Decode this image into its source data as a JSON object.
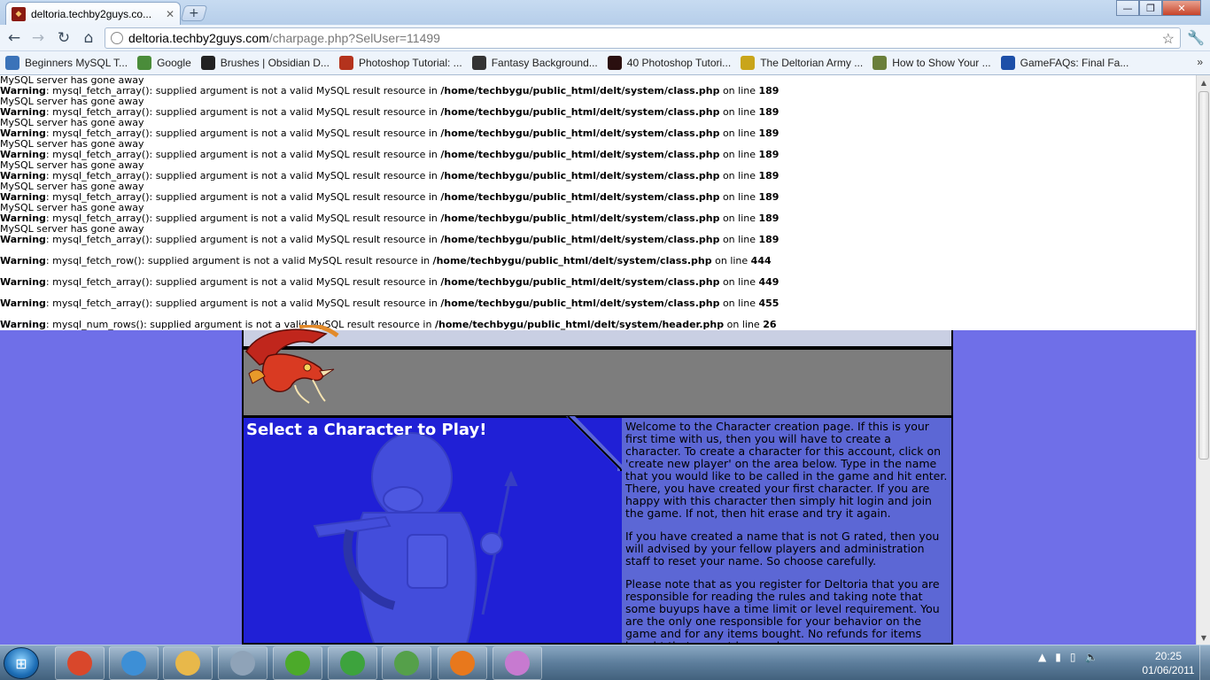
{
  "browser": {
    "tab_title": "deltoria.techby2guys.co...",
    "new_tab": "+",
    "url_host": "deltoria.techby2guys.com",
    "url_path": "/charpage.php?SelUser=11499"
  },
  "bookmarks": [
    {
      "label": "Beginners MySQL T...",
      "icon": "bookmark-mysql-icon",
      "color": "#3b73b9"
    },
    {
      "label": "Google",
      "icon": "bookmark-google-icon",
      "color": "#4a8c3a"
    },
    {
      "label": "Brushes | Obsidian D...",
      "icon": "bookmark-obsidian-icon",
      "color": "#222222"
    },
    {
      "label": "Photoshop Tutorial: ...",
      "icon": "bookmark-photoshop-icon",
      "color": "#b4331d"
    },
    {
      "label": "Fantasy Background...",
      "icon": "bookmark-fantasy-icon",
      "color": "#333333"
    },
    {
      "label": "40 Photoshop Tutori...",
      "icon": "bookmark-v-icon",
      "color": "#2a0f0f"
    },
    {
      "label": "The Deltorian Army ...",
      "icon": "bookmark-deltorian-icon",
      "color": "#c9a51a"
    },
    {
      "label": "How to Show Your ...",
      "icon": "bookmark-howto-icon",
      "color": "#6a7f3a"
    },
    {
      "label": "GameFAQs: Final Fa...",
      "icon": "bookmark-gamefaqs-icon",
      "color": "#1d4fa8"
    }
  ],
  "bookmarks_more": "»",
  "errors": [
    {
      "type": "plain",
      "text": "MySQL server has gone away"
    },
    {
      "type": "warn",
      "label": "Warning",
      "fn": ": mysql_fetch_array(): supplied argument is not a valid MySQL result resource in ",
      "path": "/home/techbygu/public_html/delt/system/class.php",
      "on": " on line ",
      "line": "189"
    },
    {
      "type": "plain",
      "text": "MySQL server has gone away"
    },
    {
      "type": "warn",
      "label": "Warning",
      "fn": ": mysql_fetch_array(): supplied argument is not a valid MySQL result resource in ",
      "path": "/home/techbygu/public_html/delt/system/class.php",
      "on": " on line ",
      "line": "189"
    },
    {
      "type": "plain",
      "text": "MySQL server has gone away"
    },
    {
      "type": "warn",
      "label": "Warning",
      "fn": ": mysql_fetch_array(): supplied argument is not a valid MySQL result resource in ",
      "path": "/home/techbygu/public_html/delt/system/class.php",
      "on": " on line ",
      "line": "189"
    },
    {
      "type": "plain",
      "text": "MySQL server has gone away"
    },
    {
      "type": "warn",
      "label": "Warning",
      "fn": ": mysql_fetch_array(): supplied argument is not a valid MySQL result resource in ",
      "path": "/home/techbygu/public_html/delt/system/class.php",
      "on": " on line ",
      "line": "189"
    },
    {
      "type": "plain",
      "text": "MySQL server has gone away"
    },
    {
      "type": "warn",
      "label": "Warning",
      "fn": ": mysql_fetch_array(): supplied argument is not a valid MySQL result resource in ",
      "path": "/home/techbygu/public_html/delt/system/class.php",
      "on": " on line ",
      "line": "189"
    },
    {
      "type": "plain",
      "text": "MySQL server has gone away"
    },
    {
      "type": "warn",
      "label": "Warning",
      "fn": ": mysql_fetch_array(): supplied argument is not a valid MySQL result resource in ",
      "path": "/home/techbygu/public_html/delt/system/class.php",
      "on": " on line ",
      "line": "189"
    },
    {
      "type": "plain",
      "text": "MySQL server has gone away"
    },
    {
      "type": "warn",
      "label": "Warning",
      "fn": ": mysql_fetch_array(): supplied argument is not a valid MySQL result resource in ",
      "path": "/home/techbygu/public_html/delt/system/class.php",
      "on": " on line ",
      "line": "189"
    },
    {
      "type": "plain",
      "text": "MySQL server has gone away"
    },
    {
      "type": "warn",
      "label": "Warning",
      "fn": ": mysql_fetch_array(): supplied argument is not a valid MySQL result resource in ",
      "path": "/home/techbygu/public_html/delt/system/class.php",
      "on": " on line ",
      "line": "189"
    },
    {
      "type": "blank"
    },
    {
      "type": "warn",
      "label": "Warning",
      "fn": ": mysql_fetch_row(): supplied argument is not a valid MySQL result resource in ",
      "path": "/home/techbygu/public_html/delt/system/class.php",
      "on": " on line ",
      "line": "444"
    },
    {
      "type": "blank"
    },
    {
      "type": "warn",
      "label": "Warning",
      "fn": ": mysql_fetch_array(): supplied argument is not a valid MySQL result resource in ",
      "path": "/home/techbygu/public_html/delt/system/class.php",
      "on": " on line ",
      "line": "449"
    },
    {
      "type": "blank"
    },
    {
      "type": "warn",
      "label": "Warning",
      "fn": ": mysql_fetch_array(): supplied argument is not a valid MySQL result resource in ",
      "path": "/home/techbygu/public_html/delt/system/class.php",
      "on": " on line ",
      "line": "455"
    },
    {
      "type": "blank"
    },
    {
      "type": "warn",
      "label": "Warning",
      "fn": ": mysql_num_rows(): supplied argument is not a valid MySQL result resource in ",
      "path": "/home/techbygu/public_html/delt/system/header.php",
      "on": " on line ",
      "line": "26"
    }
  ],
  "page": {
    "heading": "Select a Character to Play!",
    "paragraphs": [
      "Welcome to the Character creation page. If this is your first time with us, then you will have to create a character. To create a character for this account, click on 'create new player' on the area below. Type in the name that you would like to be called in the game and hit enter. There, you have created your first character. If you are happy with this character then simply hit login and join the game. If not, then hit erase and try it again.",
      "If you have created a name that is not G rated, then you will advised by your fellow players and administration staff to reset your name. So choose carefully.",
      "Please note that as you register for Deltoria that you are responsible for reading the rules and taking note that some buyups have a time limit or level requirement. You are the only one responsible for your behavior on the game and for any items bought. No refunds for items bought that cannot be used."
    ]
  },
  "taskbar": {
    "apps": [
      {
        "name": "taskbar-chrome",
        "icon": "chrome-icon",
        "color": "#d9472b"
      },
      {
        "name": "taskbar-safari",
        "icon": "safari-icon",
        "color": "#3d8fd6"
      },
      {
        "name": "taskbar-explorer",
        "icon": "folder-icon",
        "color": "#e8b84a"
      },
      {
        "name": "taskbar-calculator",
        "icon": "calculator-icon",
        "color": "#8fa3b8"
      },
      {
        "name": "taskbar-xbox",
        "icon": "xbox-icon",
        "color": "#4caa2a"
      },
      {
        "name": "taskbar-utorrent",
        "icon": "utorrent-icon",
        "color": "#3da33d"
      },
      {
        "name": "taskbar-messenger",
        "icon": "messenger-icon",
        "color": "#55a04a"
      },
      {
        "name": "taskbar-firefox",
        "icon": "firefox-icon",
        "color": "#e8781c"
      },
      {
        "name": "taskbar-paint",
        "icon": "paint-icon",
        "color": "#c77ad0"
      }
    ],
    "time": "20:25",
    "date": "01/06/2011"
  },
  "colors": {
    "page_bg": "#6f6fe8",
    "panel_blue": "#2020d6",
    "panel_info": "#5c67d5",
    "banner_gray": "#7d7d7d"
  }
}
